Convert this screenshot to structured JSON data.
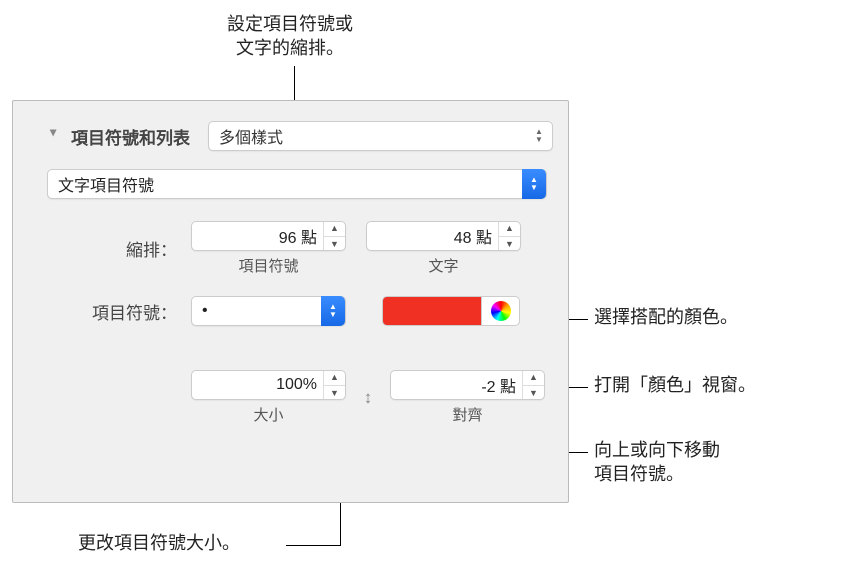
{
  "callouts": {
    "indent": "設定項目符號或\n文字的縮排。",
    "choose_color": "選擇搭配的顏色。",
    "open_color_window": "打開「顏色」視窗。",
    "move_bullet": "向上或向下移動\n項目符號。",
    "change_size": "更改項目符號大小。"
  },
  "panel": {
    "section_title": "項目符號和列表",
    "style_select": "多個樣式",
    "bullet_type_select": "文字項目符號",
    "indent": {
      "label": "縮排：",
      "bullet": {
        "value": "96 點",
        "sub": "項目符號"
      },
      "text": {
        "value": "48 點",
        "sub": "文字"
      }
    },
    "bullet": {
      "label": "項目符號：",
      "value": "•"
    },
    "size": {
      "value": "100%",
      "sub": "大小"
    },
    "align": {
      "value": "-2 點",
      "sub": "對齊"
    }
  }
}
